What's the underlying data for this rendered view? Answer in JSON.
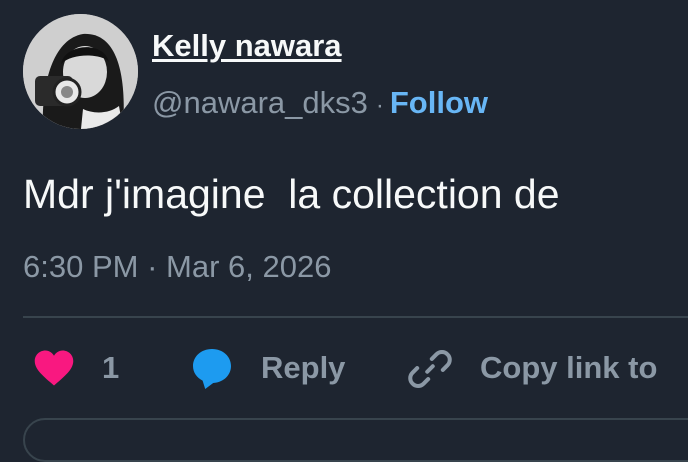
{
  "user": {
    "name": "Kelly nawara",
    "handle": "@nawara_dks3",
    "separator": "·",
    "follow_label": "Follow"
  },
  "tweet": {
    "text": "Mdr j'imagine  la collection de",
    "time": "6:30 PM",
    "date_separator": "·",
    "date": "Mar 6, 2026"
  },
  "actions": {
    "like_count": "1",
    "reply_label": "Reply",
    "copy_link_label": "Copy link to"
  },
  "colors": {
    "background": "#1e2530",
    "primary_text": "#f7f9f9",
    "secondary_text": "#8b98a5",
    "follow": "#68b6f5",
    "heart": "#f91880",
    "reply_bubble": "#1d9bf0",
    "divider": "#38444d"
  },
  "icons": [
    "heart-icon",
    "reply-bubble-icon",
    "link-icon"
  ]
}
